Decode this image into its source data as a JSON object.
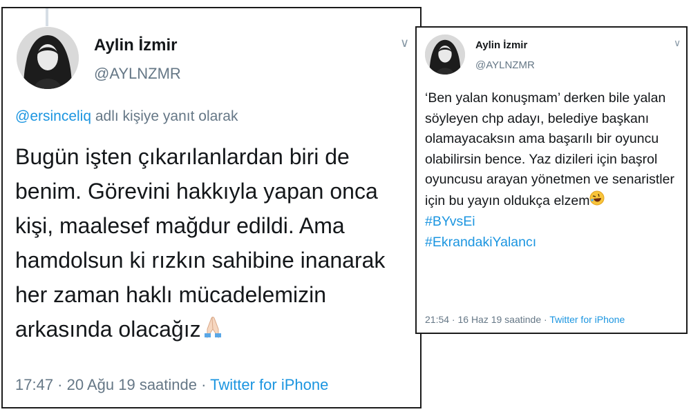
{
  "left_tweet": {
    "name": "Aylin İzmir",
    "handle": "@AYLNZMR",
    "reply_mention": "@ersinceliq",
    "reply_suffix": " adlı kişiye yanıt olarak",
    "text": "Bugün işten çıkarılanlardan biri de benim. Görevini hakkıyla yapan onca kişi, maalesef mağdur edildi. Ama hamdolsun ki rızkın sahibine inanarak her zaman haklı mücadelemizin arkasında olacağız",
    "emoji_icon": "folded-hands-icon",
    "timestamp": "17:47 · 20 Ağu 19 saatinde · ",
    "source": "Twitter for iPhone"
  },
  "right_tweet": {
    "name": "Aylin İzmir",
    "handle": "@AYLNZMR",
    "text": "‘Ben yalan konuşmam’ derken bile yalan söyleyen chp adayı, belediye başkanı olamayacaksın ama başarılı bir oyuncu olabilirsin bence. Yaz dizileri için başrol oyuncusu arayan yönetmen ve senaristler için bu yayın oldukça elzem",
    "emoji_icon": "rolling-laughing-icon",
    "hashtags": [
      "#BYvsEi",
      "#EkrandakiYalancı"
    ],
    "timestamp": "21:54 · 16 Haz 19 saatinde · ",
    "source": "Twitter for iPhone"
  },
  "colors": {
    "link": "#1b95e0",
    "muted": "#657786",
    "text": "#14171a",
    "border": "#1a1a1a"
  }
}
